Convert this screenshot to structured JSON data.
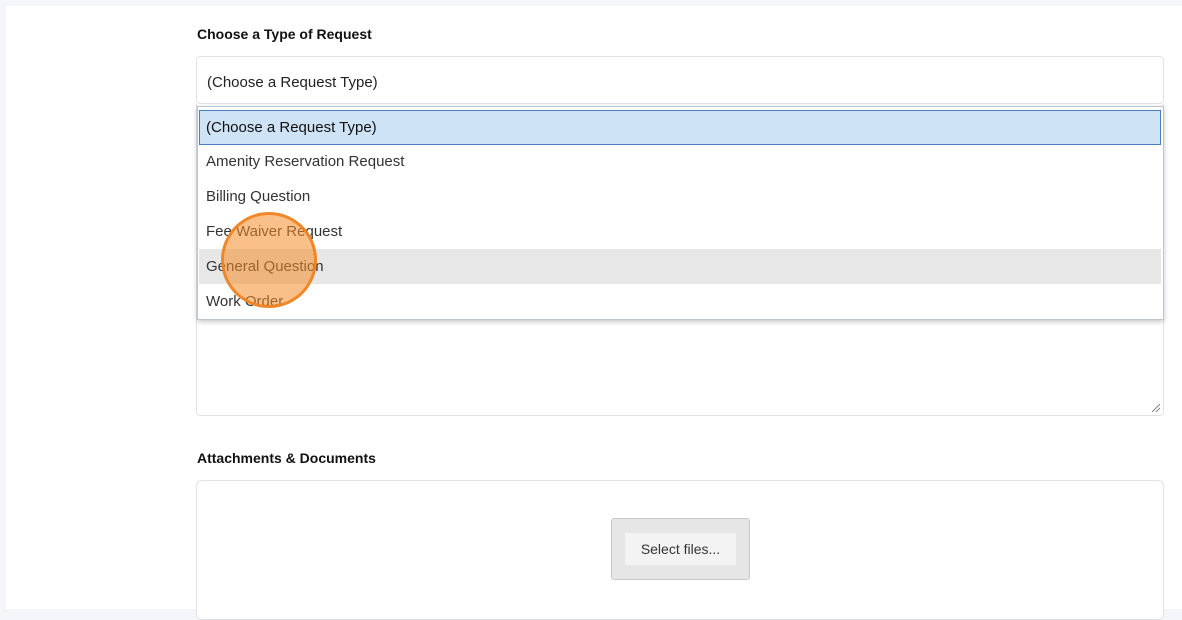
{
  "form": {
    "request_type_label": "Choose a Type of Request",
    "select_value": "(Choose a Request Type)",
    "dropdown_options": [
      "(Choose a Request Type)",
      "Amenity Reservation Request",
      "Billing Question",
      "Fee Waiver Request",
      "General Question",
      "Work Order"
    ],
    "attachments_label": "Attachments & Documents",
    "select_files_label": "Select files..."
  },
  "colors": {
    "selected_option_bg": "#cfe3f6",
    "hover_option_bg": "#e7e7e7",
    "click_marker": "#f58c28"
  }
}
